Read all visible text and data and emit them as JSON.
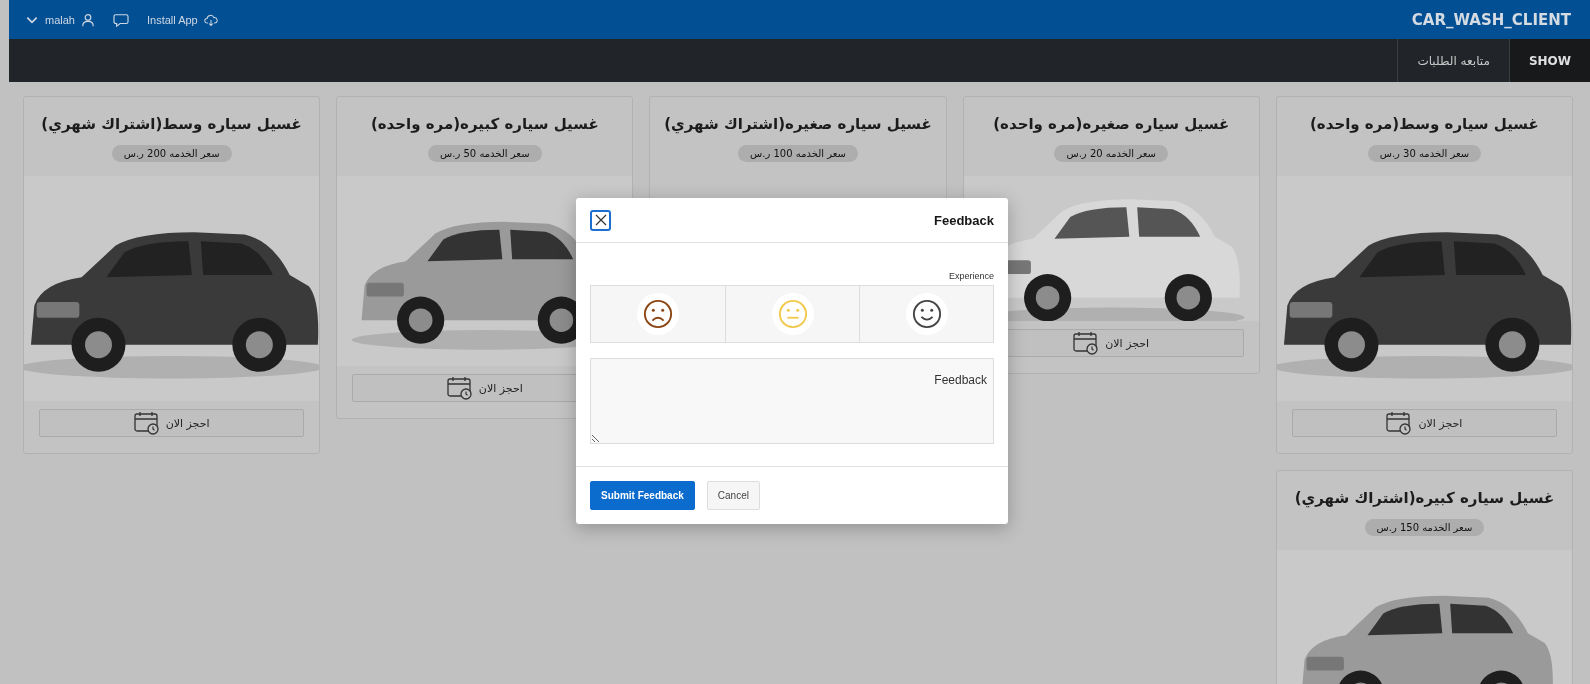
{
  "header": {
    "app_title": "CAR_WASH_CLIENT",
    "user": "malah",
    "install": "Install App"
  },
  "nav": {
    "tabs": [
      {
        "label": "SHOW",
        "selected": true
      },
      {
        "label": "متابعه الطلبات",
        "selected": false
      }
    ]
  },
  "cards": [
    {
      "title": "غسيل سياره وسط(مره واحده)",
      "price": "سعر الخدمه 30 ر.س",
      "button": "احجز الان"
    },
    {
      "title": "غسيل سياره صغيره(مره واحده)",
      "price": "سعر الخدمه 20 ر.س",
      "button": "احجز الان"
    },
    {
      "title": "غسيل سياره صغيره(اشتراك شهري)",
      "price": "سعر الخدمه 100 ر.س"
    },
    {
      "title": "غسيل سياره كبيره(مره واحده)",
      "price": "سعر الخدمه 50 ر.س",
      "button": "احجز الان"
    },
    {
      "title": "غسيل سياره وسط(اشتراك شهري)",
      "price": "سعر الخدمه 200 ر.س",
      "button": "احجز الان"
    },
    {
      "title": "غسيل سياره كبيره(اشتراك شهري)",
      "price": "سعر الخدمه 150 ر.س"
    }
  ],
  "dialog": {
    "title": "Feedback",
    "experience_label": "Experience",
    "ratings": [
      {
        "kind": "sad",
        "color": "#8a4513",
        "selected": false
      },
      {
        "kind": "neutral",
        "color": "#f2c94c",
        "selected": false
      },
      {
        "kind": "happy",
        "color": "#444444",
        "selected": false
      }
    ],
    "feedback_field": {
      "placeholder": "Feedback"
    },
    "submit_button": "Submit Feedback",
    "cancel_button": "Cancel"
  }
}
